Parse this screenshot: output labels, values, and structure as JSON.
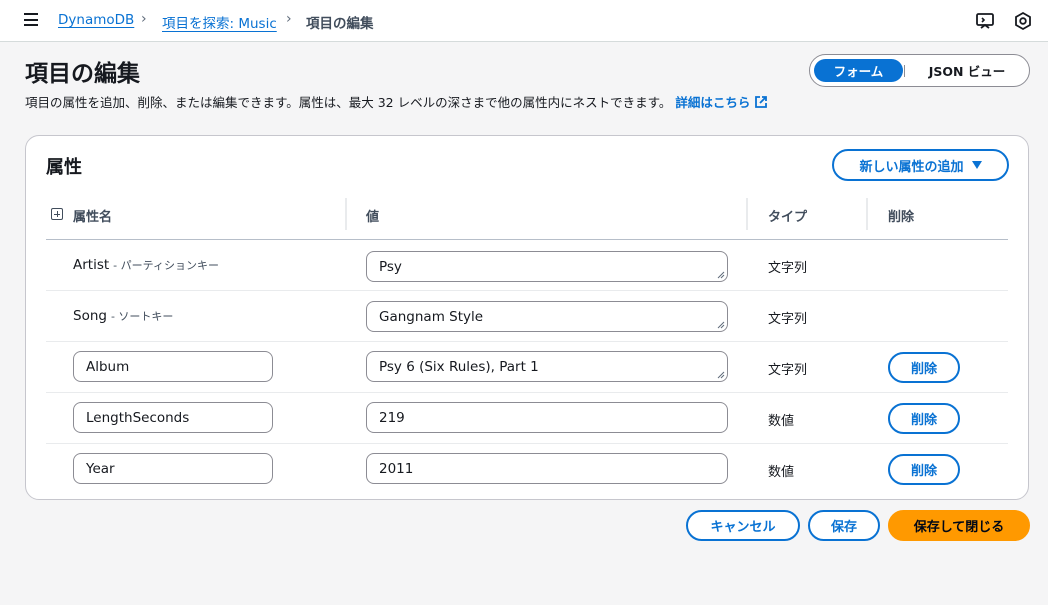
{
  "breadcrumb": {
    "items": [
      "DynamoDB",
      "項目を探索: Music",
      "項目の編集"
    ]
  },
  "header": {
    "title": "項目の編集",
    "description": "項目の属性を追加、削除、または編集できます。属性は、最大 32 レベルの深さまで他の属性内にネストできます。",
    "learn_more": "詳細はこちら"
  },
  "view_toggle": {
    "options": [
      "フォーム",
      "JSON ビュー"
    ],
    "selected": "フォーム"
  },
  "attributes": {
    "title": "属性",
    "add_button": "新しい属性の追加",
    "columns": [
      "属性名",
      "値",
      "タイプ",
      "削除"
    ],
    "rows": [
      {
        "name": "Artist",
        "key_type": "- パーティションキー",
        "value": "Psy",
        "type": "文字列"
      },
      {
        "name": "Song",
        "key_type": "- ソートキー",
        "value": "Gangnam Style",
        "type": "文字列"
      },
      {
        "name": "Album",
        "value": "Psy 6 (Six Rules), Part 1",
        "type": "文字列",
        "delete": "削除"
      },
      {
        "name": "LengthSeconds",
        "value": "219",
        "type": "数値",
        "delete": "削除"
      },
      {
        "name": "Year",
        "value": "2011",
        "type": "数値",
        "delete": "削除"
      }
    ]
  },
  "footer": {
    "cancel": "キャンセル",
    "save": "保存",
    "save_close": "保存して閉じる"
  },
  "colors": {
    "accent": "#0972d3",
    "primary": "#ff9900"
  },
  "icons": [
    "menu-icon",
    "chevron-right-icon",
    "feedback-icon",
    "settings-icon",
    "external-link-icon",
    "expand-icon",
    "caret-down-icon"
  ]
}
